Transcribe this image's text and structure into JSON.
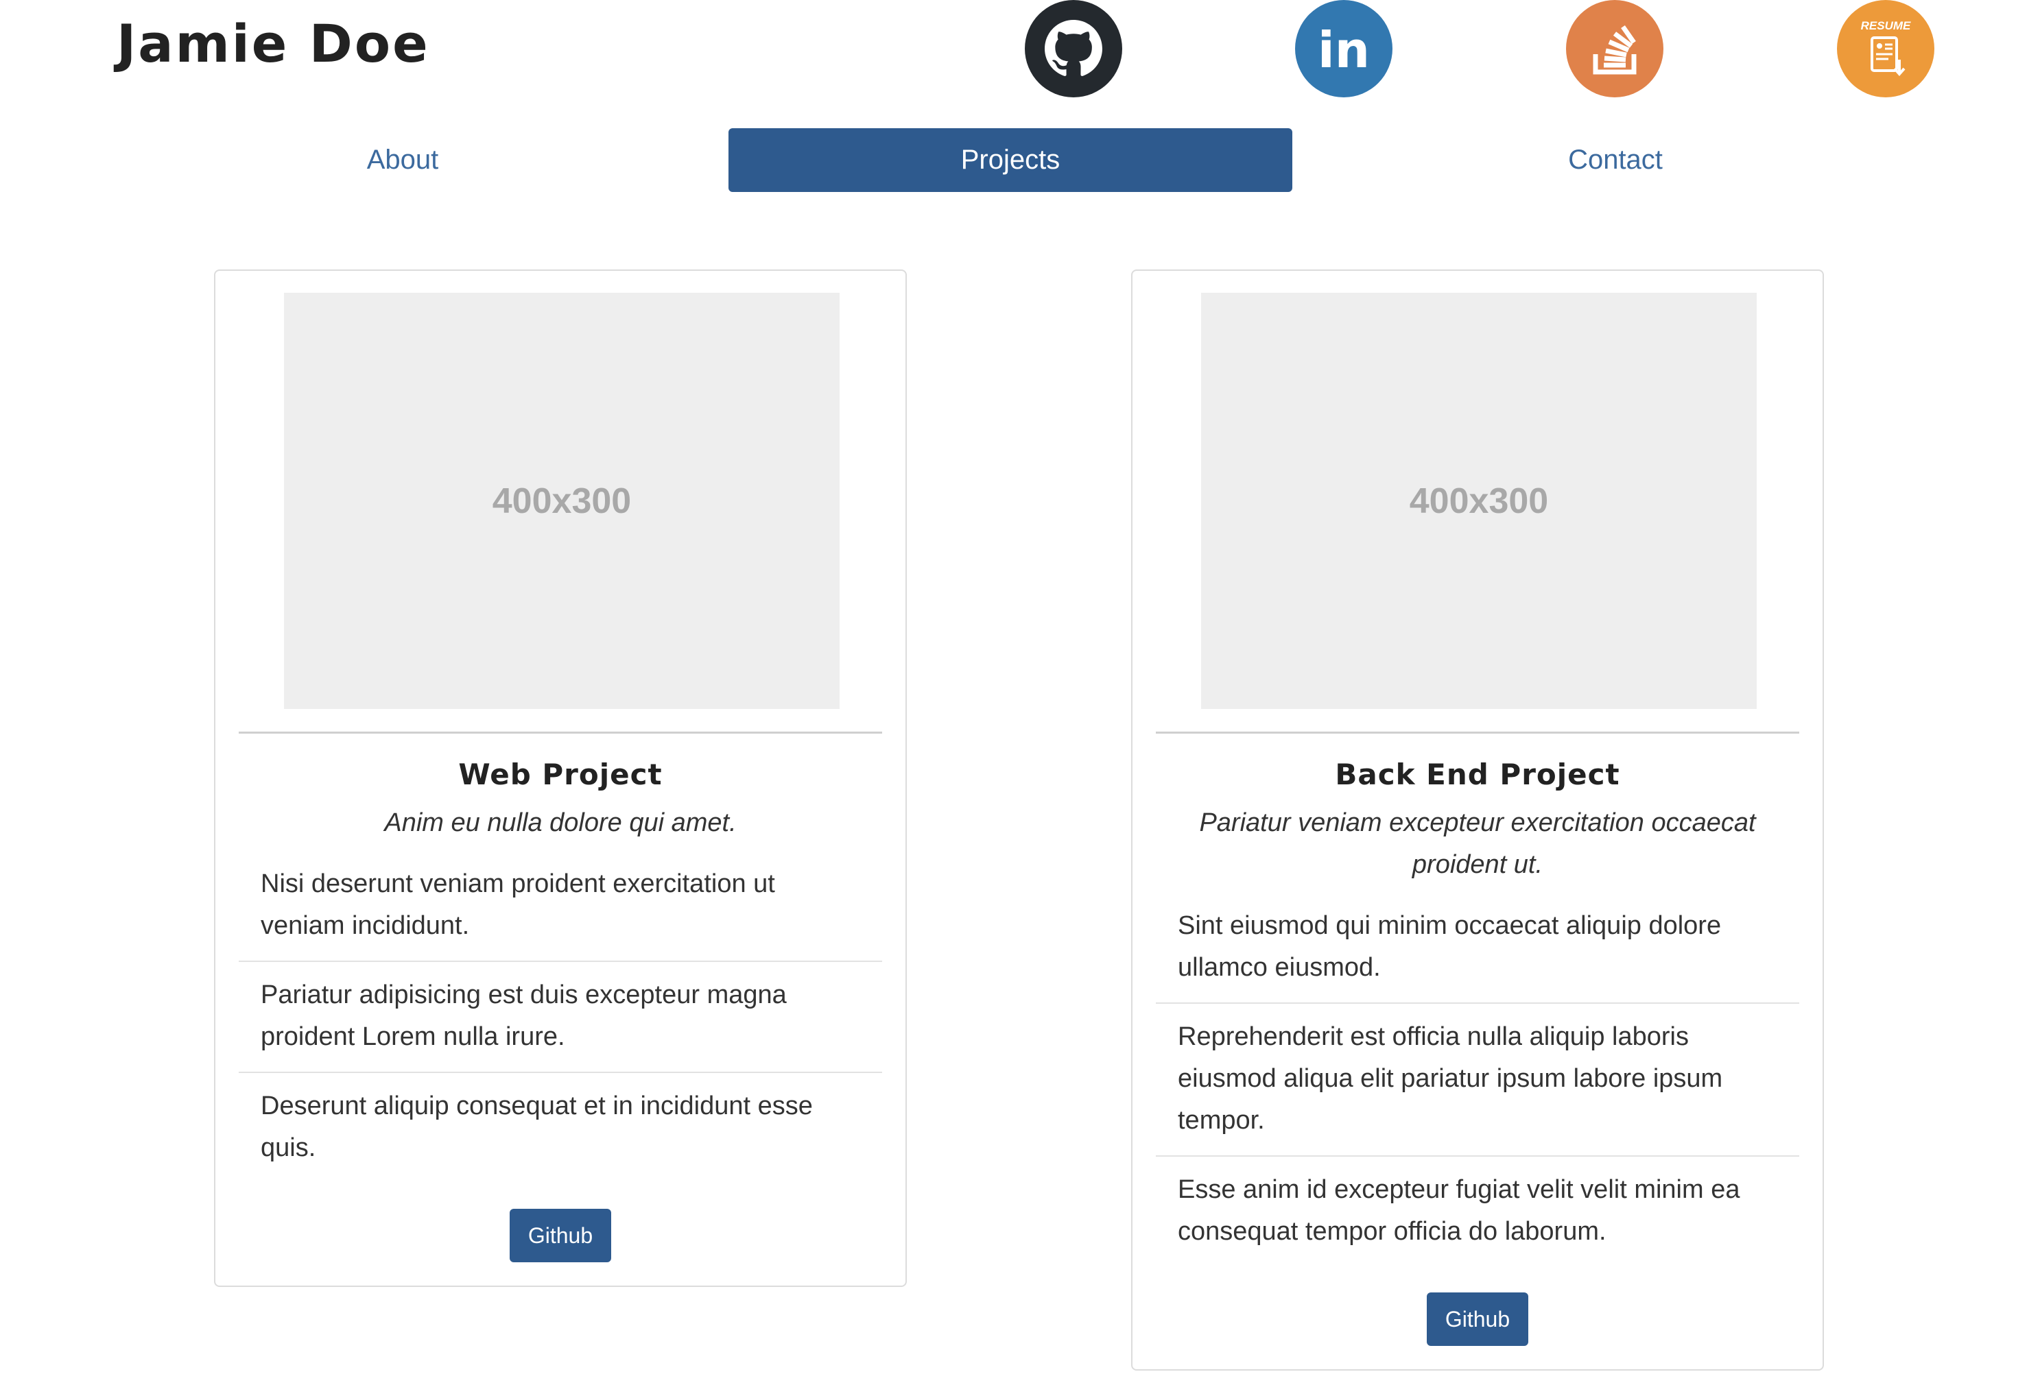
{
  "header": {
    "name": "Jamie Doe"
  },
  "social": {
    "github_icon": "github-icon",
    "linkedin_icon": "linkedin-icon",
    "linkedin_text": "in",
    "stackoverflow_icon": "stackoverflow-icon",
    "resume_icon": "resume-icon",
    "resume_text": "RESUME"
  },
  "nav": {
    "about": "About",
    "projects": "Projects",
    "contact": "Contact"
  },
  "projects": [
    {
      "image_text": "400x300",
      "title": "Web Project",
      "subtitle": "Anim eu nulla dolore qui amet.",
      "items": [
        "Nisi deserunt veniam proident exercitation ut veniam incididunt.",
        "Pariatur adipisicing est duis excepteur magna proident Lorem nulla irure.",
        "Deserunt aliquip consequat et in incididunt esse quis."
      ],
      "button": "Github"
    },
    {
      "image_text": "400x300",
      "title": "Back End Project",
      "subtitle": "Pariatur veniam excepteur exercitation occaecat proident ut.",
      "items": [
        "Sint eiusmod qui minim occaecat aliquip dolore ullamco eiusmod.",
        "Reprehenderit est officia nulla aliquip laboris eiusmod aliqua elit pariatur ipsum labore ipsum tempor.",
        "Esse anim id excepteur fugiat velit velit minim ea consequat tempor officia do laborum."
      ],
      "button": "Github"
    }
  ],
  "colors": {
    "primary": "#2e5a8e",
    "link": "#3c6a9e",
    "github": "#24292e",
    "linkedin": "#3278b0",
    "stackoverflow": "#e0824a",
    "resume": "#ed9a3a"
  }
}
